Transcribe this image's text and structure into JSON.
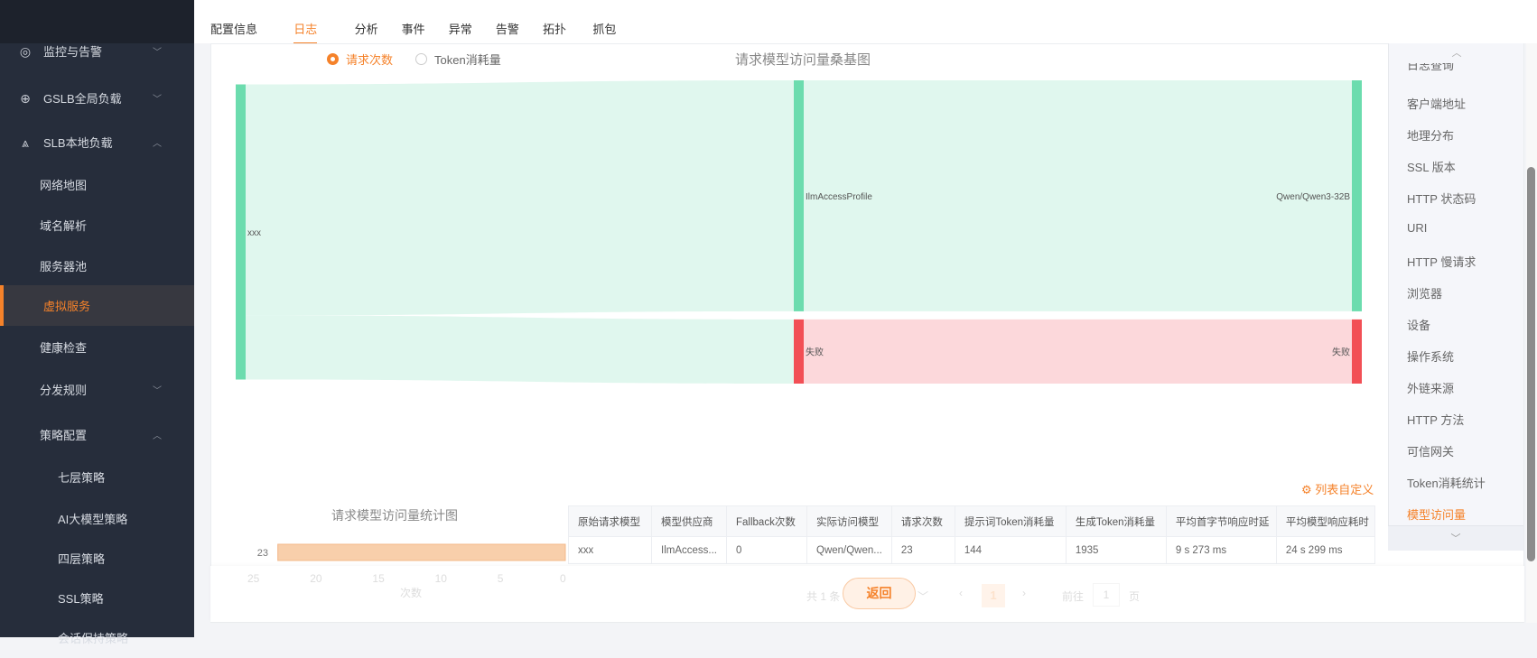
{
  "sidebar": {
    "items": [
      {
        "label": "监控与告警",
        "icon": "monitor-icon",
        "chevron": "down"
      },
      {
        "label": "GSLB全局负载",
        "icon": "globe-icon",
        "chevron": "down"
      },
      {
        "label": "SLB本地负载",
        "icon": "network-icon",
        "chevron": "up"
      },
      {
        "label": "网络地图"
      },
      {
        "label": "域名解析"
      },
      {
        "label": "服务器池"
      },
      {
        "label": "虚拟服务",
        "active": true
      },
      {
        "label": "健康检查"
      },
      {
        "label": "分发规则",
        "chevron": "down"
      },
      {
        "label": "策略配置",
        "chevron": "up"
      },
      {
        "label": "七层策略"
      },
      {
        "label": "AI大模型策略"
      },
      {
        "label": "四层策略"
      },
      {
        "label": "SSL策略"
      },
      {
        "label": "会话保持策略"
      }
    ]
  },
  "tabs": [
    "配置信息",
    "日志",
    "分析",
    "事件",
    "异常",
    "告警",
    "拓扑",
    "抓包"
  ],
  "active_tab": "日志",
  "radios": {
    "count": "请求次数",
    "token": "Token消耗量",
    "selected": "请求次数"
  },
  "colors": {
    "accent": "#f5822a",
    "success_node": "#6cdcae",
    "success_link": "#e0f7ee",
    "fail_node": "#f24f55",
    "fail_link": "#fcd8db",
    "bar": "#f8cfab"
  },
  "chart_data": [
    {
      "type": "sankey",
      "title": "请求模型访问量桑基图",
      "nodes": [
        "xxx",
        "IlmAccessProfile",
        "失败",
        "Qwen/Qwen3-32B",
        "失败 "
      ],
      "links": [
        {
          "source": "xxx",
          "target": "IlmAccessProfile",
          "value": 18
        },
        {
          "source": "xxx",
          "target": "失败",
          "value": 5
        },
        {
          "source": "IlmAccessProfile",
          "target": "Qwen/Qwen3-32B",
          "value": 18
        },
        {
          "source": "失败",
          "target": "失败 ",
          "value": 5
        }
      ]
    },
    {
      "type": "bar",
      "orientation": "horizontal",
      "title": "请求模型访问量统计图",
      "categories": [
        "23"
      ],
      "values": [
        23
      ],
      "xlabel": "次数",
      "xlim": [
        25,
        0
      ],
      "xticks": [
        "25",
        "20",
        "15",
        "10",
        "5",
        "0"
      ]
    }
  ],
  "right_panel": {
    "items": [
      "日志查询",
      "客户端地址",
      "地理分布",
      "SSL 版本",
      "HTTP 状态码",
      "URI",
      "HTTP 慢请求",
      "浏览器",
      "设备",
      "操作系统",
      "外链来源",
      "HTTP 方法",
      "可信网关",
      "Token消耗统计",
      "模型访问量"
    ],
    "active": "模型访问量"
  },
  "customize": "列表自定义",
  "table": {
    "headers": [
      "原始请求模型",
      "模型供应商",
      "Fallback次数",
      "实际访问模型",
      "请求次数",
      "提示词Token消耗量",
      "生成Token消耗量",
      "平均首字节响应时延",
      "平均模型响应耗时"
    ],
    "rows": [
      [
        "xxx",
        "IlmAccess...",
        "0",
        "Qwen/Qwen...",
        "23",
        "144",
        "1935",
        "9 s 273 ms",
        "24 s 299 ms"
      ]
    ]
  },
  "pagination": {
    "total": "共 1 条",
    "page": "1",
    "goto": "前往",
    "goto_value": "1",
    "page_unit": "页"
  },
  "back_button": "返回"
}
